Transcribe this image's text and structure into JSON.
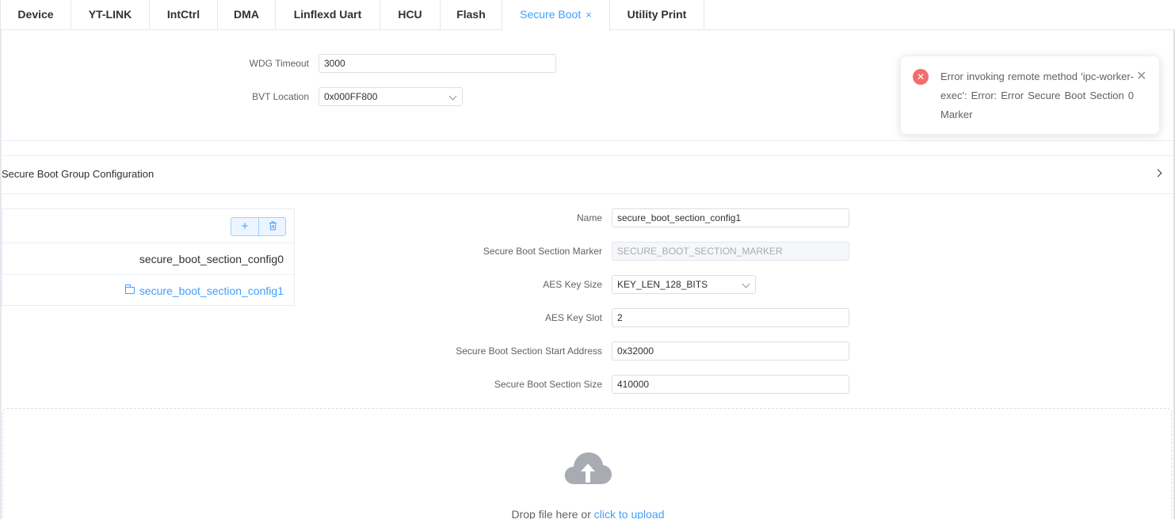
{
  "tabs": [
    {
      "label": "Device"
    },
    {
      "label": "YT-LINK"
    },
    {
      "label": "IntCtrl"
    },
    {
      "label": "DMA"
    },
    {
      "label": "Linflexd Uart"
    },
    {
      "label": "HCU"
    },
    {
      "label": "Flash"
    },
    {
      "label": "Secure Boot",
      "active": true,
      "close": "×"
    },
    {
      "label": "Utility Print"
    }
  ],
  "general": {
    "wdg_timeout_label": "WDG Timeout",
    "wdg_timeout_value": "3000",
    "bvt_location_label": "BVT Location",
    "bvt_location_value": "0x000FF800"
  },
  "group": {
    "title": "Secure Boot Group Configuration",
    "add": "+",
    "delete": "🗑",
    "items": [
      {
        "label": "secure_boot_section_config0"
      },
      {
        "label": "secure_boot_section_config1",
        "selected": true
      }
    ]
  },
  "section": {
    "name_label": "Name",
    "name_value": "secure_boot_section_config1",
    "marker_label": "Secure Boot Section Marker",
    "marker_value": "SECURE_BOOT_SECTION_MARKER",
    "aes_key_size_label": "AES Key Size",
    "aes_key_size_value": "KEY_LEN_128_BITS",
    "aes_key_slot_label": "AES Key Slot",
    "aes_key_slot_value": "2",
    "start_address_label": "Secure Boot Section Start Address",
    "start_address_value": "0x32000",
    "size_label": "Secure Boot Section Size",
    "size_value": "410000"
  },
  "upload": {
    "text": "Drop file here or ",
    "link": "click to upload"
  },
  "toast": {
    "icon": "✕",
    "message": "Error invoking remote method 'ipc-worker-exec': Error: Error Secure Boot Section 0 Marker",
    "close": "✕",
    "color": "#f56c6c"
  },
  "colors": {
    "accent": "#409eff",
    "error": "#f56c6c"
  }
}
